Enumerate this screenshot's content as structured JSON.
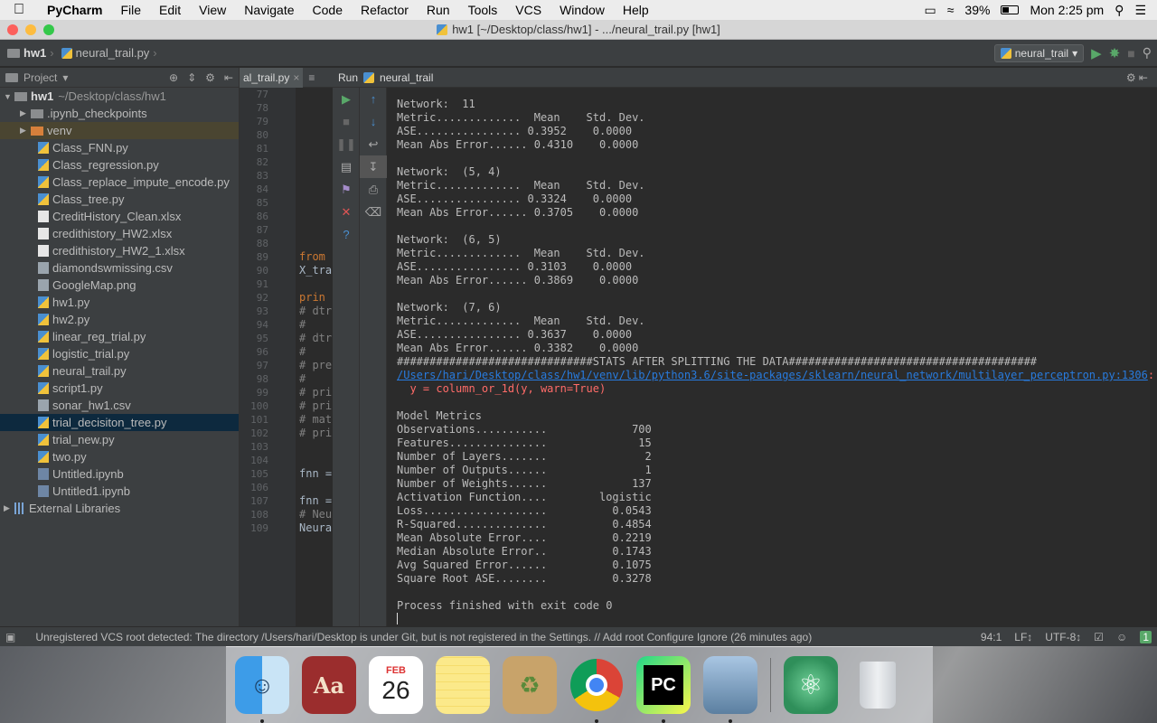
{
  "menubar": {
    "items": [
      "PyCharm",
      "File",
      "Edit",
      "View",
      "Navigate",
      "Code",
      "Refactor",
      "Run",
      "Tools",
      "VCS",
      "Window",
      "Help"
    ],
    "battery": "39%",
    "clock": "Mon 2:25 pm"
  },
  "window": {
    "title": "hw1 [~/Desktop/class/hw1] - .../neural_trail.py [hw1]"
  },
  "navbar": {
    "project": "hw1",
    "file": "neural_trail.py",
    "run_config": "neural_trail"
  },
  "project_panel": {
    "label": "Project",
    "root_name": "hw1",
    "root_path": "~/Desktop/class/hw1",
    "items": [
      {
        "name": ".ipynb_checkpoints",
        "type": "folder"
      },
      {
        "name": "venv",
        "type": "folder-orange"
      },
      {
        "name": "Class_FNN.py",
        "type": "py"
      },
      {
        "name": "Class_regression.py",
        "type": "py"
      },
      {
        "name": "Class_replace_impute_encode.py",
        "type": "py"
      },
      {
        "name": "Class_tree.py",
        "type": "py"
      },
      {
        "name": "CreditHistory_Clean.xlsx",
        "type": "doc"
      },
      {
        "name": "credithistory_HW2.xlsx",
        "type": "doc"
      },
      {
        "name": "credithistory_HW2_1.xlsx",
        "type": "doc"
      },
      {
        "name": "diamondswmissing.csv",
        "type": "csv"
      },
      {
        "name": "GoogleMap.png",
        "type": "csv"
      },
      {
        "name": "hw1.py",
        "type": "py"
      },
      {
        "name": "hw2.py",
        "type": "py"
      },
      {
        "name": "linear_reg_trial.py",
        "type": "py"
      },
      {
        "name": "logistic_trial.py",
        "type": "py"
      },
      {
        "name": "neural_trail.py",
        "type": "py"
      },
      {
        "name": "script1.py",
        "type": "py"
      },
      {
        "name": "sonar_hw1.csv",
        "type": "csv"
      },
      {
        "name": "trial_decisiton_tree.py",
        "type": "py"
      },
      {
        "name": "trial_new.py",
        "type": "py"
      },
      {
        "name": "two.py",
        "type": "py"
      },
      {
        "name": "Untitled.ipynb",
        "type": "nb"
      },
      {
        "name": "Untitled1.ipynb",
        "type": "nb"
      }
    ],
    "external": "External Libraries"
  },
  "editor": {
    "tab": "al_trail.py",
    "line_numbers": [
      "77",
      "78",
      "79",
      "80",
      "81",
      "82",
      "83",
      "84",
      "85",
      "86",
      "87",
      "88",
      "89",
      "90",
      "91",
      "92",
      "93",
      "94",
      "95",
      "96",
      "97",
      "98",
      "99",
      "100",
      "101",
      "102",
      "103",
      "104",
      "105",
      "106",
      "107",
      "108",
      "109"
    ],
    "snippets": [
      {
        "line": 89,
        "text": "from",
        "cls": "kw"
      },
      {
        "line": 90,
        "text": "X_tra",
        "cls": "tx"
      },
      {
        "line": 92,
        "text": "prin",
        "cls": "kw"
      },
      {
        "line": 93,
        "text": "# dtr",
        "cls": "cm"
      },
      {
        "line": 94,
        "text": "#",
        "cls": "cm"
      },
      {
        "line": 95,
        "text": "# dtr",
        "cls": "cm"
      },
      {
        "line": 96,
        "text": "#",
        "cls": "cm"
      },
      {
        "line": 97,
        "text": "# pre",
        "cls": "cm"
      },
      {
        "line": 98,
        "text": "#",
        "cls": "cm"
      },
      {
        "line": 99,
        "text": "# pri",
        "cls": "cm"
      },
      {
        "line": 100,
        "text": "# pri",
        "cls": "cm"
      },
      {
        "line": 101,
        "text": "# mat",
        "cls": "cm"
      },
      {
        "line": 102,
        "text": "# pri",
        "cls": "cm"
      },
      {
        "line": 105,
        "text": "fnn =",
        "cls": "tx"
      },
      {
        "line": 107,
        "text": "fnn =",
        "cls": "tx"
      },
      {
        "line": 108,
        "text": "# Neu",
        "cls": "cm"
      },
      {
        "line": 109,
        "text": "Neura",
        "cls": "tx"
      }
    ]
  },
  "run_panel": {
    "label": "Run",
    "config": "neural_trail",
    "lines": [
      {
        "t": "Network:  11"
      },
      {
        "t": "Metric.............  Mean    Std. Dev."
      },
      {
        "t": "ASE................ 0.3952    0.0000"
      },
      {
        "t": "Mean Abs Error...... 0.4310    0.0000"
      },
      {
        "t": ""
      },
      {
        "t": "Network:  (5, 4)"
      },
      {
        "t": "Metric.............  Mean    Std. Dev."
      },
      {
        "t": "ASE................ 0.3324    0.0000"
      },
      {
        "t": "Mean Abs Error...... 0.3705    0.0000"
      },
      {
        "t": ""
      },
      {
        "t": "Network:  (6, 5)"
      },
      {
        "t": "Metric.............  Mean    Std. Dev."
      },
      {
        "t": "ASE................ 0.3103    0.0000"
      },
      {
        "t": "Mean Abs Error...... 0.3869    0.0000"
      },
      {
        "t": ""
      },
      {
        "t": "Network:  (7, 6)"
      },
      {
        "t": "Metric.............  Mean    Std. Dev."
      },
      {
        "t": "ASE................ 0.3637    0.0000"
      },
      {
        "t": "Mean Abs Error...... 0.3382    0.0000"
      },
      {
        "t": "##############################STATS AFTER SPLITTING THE DATA######################################"
      },
      {
        "t": "/Users/hari/Desktop/class/hw1/venv/lib/python3.6/site-packages/sklearn/neural_network/multilayer_perceptron.py:1306",
        "link": true,
        "suffix": ": Dat"
      },
      {
        "t": "  y = column_or_1d(y, warn=True)",
        "err": true
      },
      {
        "t": ""
      },
      {
        "t": "Model Metrics"
      },
      {
        "t": "Observations...........             700"
      },
      {
        "t": "Features...............              15"
      },
      {
        "t": "Number of Layers.......               2"
      },
      {
        "t": "Number of Outputs......               1"
      },
      {
        "t": "Number of Weights......             137"
      },
      {
        "t": "Activation Function....        logistic"
      },
      {
        "t": "Loss...................          0.0543"
      },
      {
        "t": "R-Squared..............          0.4854"
      },
      {
        "t": "Mean Absolute Error....          0.2219"
      },
      {
        "t": "Median Absolute Error..          0.1743"
      },
      {
        "t": "Avg Squared Error......          0.1075"
      },
      {
        "t": "Square Root ASE........          0.3278"
      },
      {
        "t": ""
      },
      {
        "t": "Process finished with exit code 0"
      }
    ]
  },
  "statusbar": {
    "message": "Unregistered VCS root detected: The directory /Users/hari/Desktop is under Git, but is not registered in the Settings. // Add root  Configure  Ignore (26 minutes ago)",
    "position": "94:1",
    "line_sep": "LF↕",
    "encoding": "UTF-8↕"
  },
  "dock": {
    "calendar_month": "FEB",
    "calendar_day": "26",
    "dictionary_label": "Aa",
    "pycharm_label": "PC"
  },
  "colors": {
    "accent": "#287bde",
    "error": "#ff6b68",
    "selection": "#0d293e"
  }
}
